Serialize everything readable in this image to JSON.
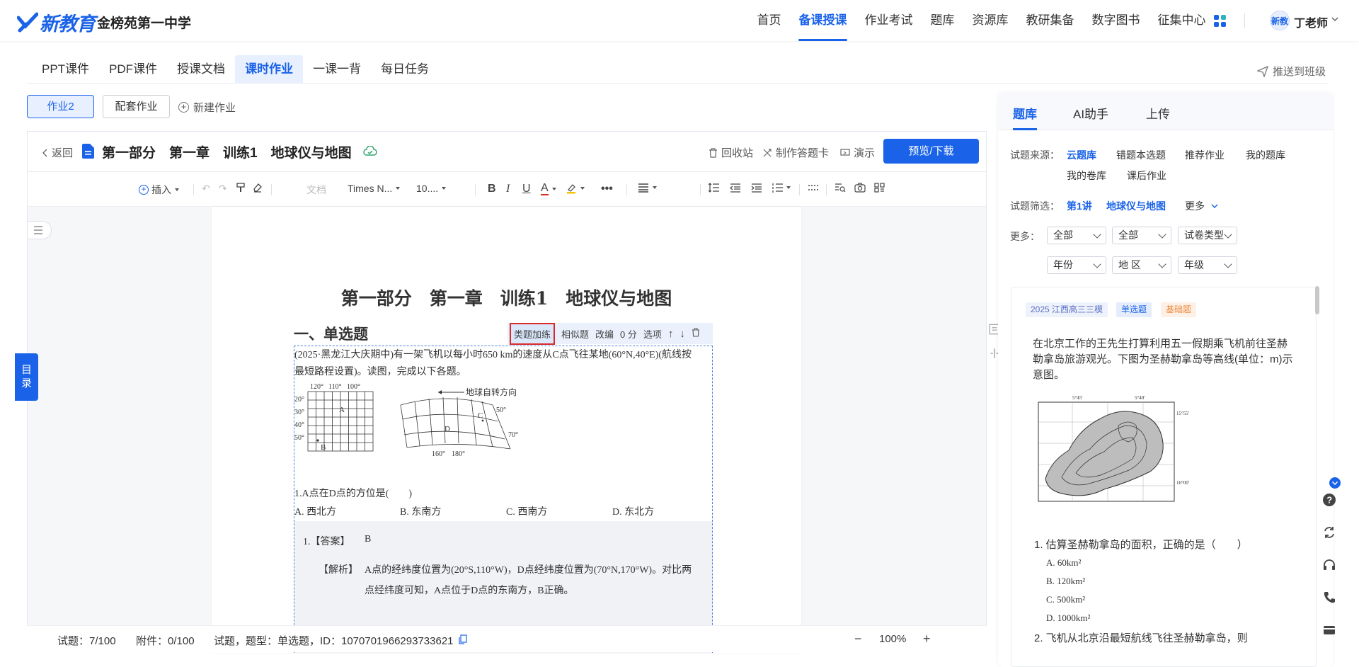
{
  "brand": {
    "logo_text": "新教育",
    "school": "金榜苑第一中学"
  },
  "nav": {
    "items": [
      {
        "label": "首页"
      },
      {
        "label": "备课授课"
      },
      {
        "label": "作业考试"
      },
      {
        "label": "题库"
      },
      {
        "label": "资源库"
      },
      {
        "label": "教研集备"
      },
      {
        "label": "数字图书"
      },
      {
        "label": "征集中心"
      }
    ],
    "active_index": 1,
    "user": "丁老师",
    "avatar_text": "新教"
  },
  "subtabs": [
    "PPT课件",
    "PDF课件",
    "授课文档",
    "课时作业",
    "一课一背",
    "每日任务"
  ],
  "subtab_active": 3,
  "push_class": "推送到班级",
  "homework": {
    "current": "作业2",
    "match": "配套作业",
    "new": "新建作业"
  },
  "doc": {
    "back": "返回",
    "title": "第一部分　第一章　训练1　地球仪与地图",
    "recycle": "回收站",
    "answer_card": "制作答题卡",
    "present": "演示",
    "preview": "预览/下载"
  },
  "toolbar": {
    "insert": "插入",
    "style": "文档",
    "font": "Times N...",
    "size": "10...."
  },
  "page": {
    "title": "第一部分　第一章　训练1　地球仪与地图",
    "section": "一、单选题",
    "tools": [
      "类题加练",
      "相似题",
      "改编",
      "0 分",
      "选项"
    ],
    "stem_line1": "(2025·黑龙江大庆期中)有一架飞机以每小时650 km的速度从C点飞往某地(60°N,40°E)(航线按",
    "stem_line2": "最短路程设置)。读图，完成以下各题。",
    "map_left": {
      "top_labels": [
        "120°",
        "110°",
        "100°"
      ],
      "left_labels": [
        "20°",
        "30°",
        "40°",
        "50°"
      ],
      "points": [
        "A",
        "B"
      ]
    },
    "map_right": {
      "arrow_label": "地球自转方向",
      "right_labels": [
        "50°",
        "70°"
      ],
      "bottom_labels": [
        "160°",
        "180°"
      ],
      "points": [
        "C",
        "D"
      ]
    },
    "question": "1.A点在D点的方位是(　　)",
    "options": [
      "A.  西北方",
      "B.  东南方",
      "C.  西南方",
      "D.  东北方"
    ],
    "answer_label": "1.【答案】",
    "answer": "B",
    "analysis_label": "【解析】",
    "analysis_line1": "A点的经纬度位置为(20°S,110°W)，D点经纬度位置为(70°N,170°W)。对比两",
    "analysis_line2": "点经纬度可知，A点位于D点的东南方，B正确。"
  },
  "status": {
    "questions": "试题：7/100",
    "attachments": "附件：0/100",
    "meta": "试题，题型：单选题，ID：1070701966293733621",
    "zoom": "100%",
    "minus": "−",
    "plus": "+"
  },
  "toc": "目录",
  "panel": {
    "tabs": [
      "题库",
      "AI助手",
      "上传"
    ],
    "source_label": "试题来源：",
    "sources": [
      "云题库",
      "错题本选题",
      "推荐作业",
      "我的题库",
      "我的卷库",
      "课后作业"
    ],
    "filter_label": "试题筛选：",
    "filters": [
      "第1讲",
      "地球仪与地图",
      "更多"
    ],
    "more_label": "更多：",
    "selects": [
      "全部",
      "全部",
      "试卷类型",
      "年份",
      "地 区",
      "年级"
    ],
    "card": {
      "tags": [
        "2025 江西高三三模",
        "单选题",
        "基础题"
      ],
      "text": "在北京工作的王先生打算利用五一假期乘飞机前往圣赫勒拿岛旅游观光。下图为圣赫勒拿岛等高线(单位：m)示意图。",
      "map_labels": [
        "5°45′",
        "5°40′",
        "15°55′",
        "16°00′"
      ],
      "q1": "1. 估算圣赫勒拿岛的面积，正确的是（　　）",
      "q1_options": [
        "A.  60km²",
        "B.  120km²",
        "C.  500km²",
        "D.  1000km²"
      ],
      "q2": "2. 飞机从北京沿最短航线飞往圣赫勒拿岛，则"
    }
  },
  "colors": {
    "brand": "#1a63e8",
    "highlight_border": "#d92a2a",
    "tag_orange": "#f08a3c"
  }
}
